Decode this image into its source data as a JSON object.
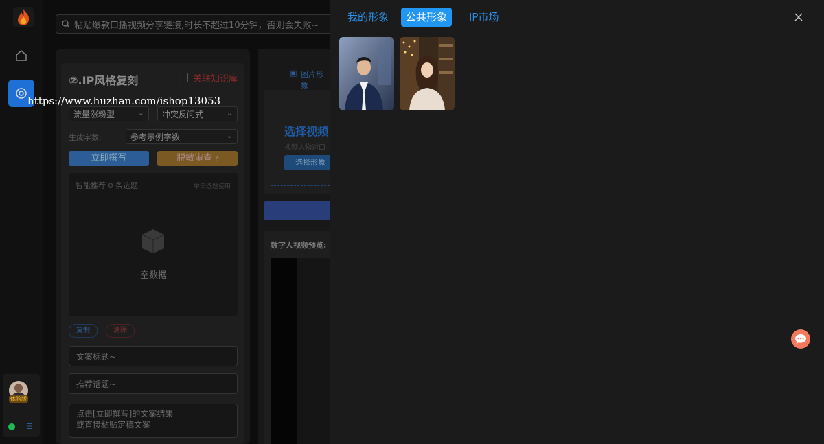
{
  "search": {
    "placeholder": "粘贴爆款口播视频分享链接,时长不超过10分钟，否则会失败~"
  },
  "left_panel": {
    "title": "②.IP风格复刻",
    "knowledge_checkbox_label": "关联知识库",
    "select_type": "流量涨粉型",
    "select_style": "冲突反问式",
    "word_count_label": "生成字数:",
    "word_count_value": "参考示例字数",
    "write_button": "立即撰写",
    "review_button": "脱敏审查",
    "recommend_label": "智能推荐 0 条选题",
    "recommend_hint": "单击选题使用",
    "empty_text": "空数据",
    "copy_tag": "复制",
    "clear_tag": "清除",
    "title_placeholder": "文案标题~",
    "topic_placeholder": "推荐话题~",
    "result_placeholder_line1": "点击[立即撰写]的文案结果",
    "result_placeholder_line2": "或直接粘贴定稿文案"
  },
  "mid_panel": {
    "image_tab": "图片形象",
    "select_video_heading": "选择视频",
    "video_desc": "视频人物对口",
    "select_avatar_button": "选择形象",
    "preview_label": "数字人视频预览:"
  },
  "user": {
    "name": "体验版"
  },
  "drawer": {
    "tabs": [
      {
        "label": "我的形象",
        "active": false
      },
      {
        "label": "公共形象",
        "active": true
      },
      {
        "label": "IP市场",
        "active": false
      }
    ],
    "accent_color": "#2196f3"
  },
  "watermark": "https://www.huzhan.com/ishop13053"
}
